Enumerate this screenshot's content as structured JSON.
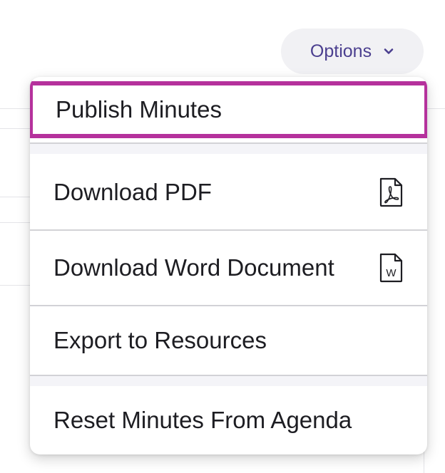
{
  "header": {
    "options_label": "Options",
    "options_icon": "chevron-down-icon"
  },
  "menu": {
    "items": [
      {
        "label": "Publish Minutes",
        "highlighted": true
      },
      {
        "label": "Download PDF",
        "icon": "pdf-file-icon"
      },
      {
        "label": "Download Word Document",
        "icon": "word-file-icon",
        "icon_letter": "W"
      },
      {
        "label": "Export to Resources"
      },
      {
        "label": "Reset Minutes From Agenda"
      }
    ]
  },
  "colors": {
    "accent_text": "#4b3f8f",
    "highlight_border": "#b5319c",
    "button_bg": "#f1f1f4"
  }
}
